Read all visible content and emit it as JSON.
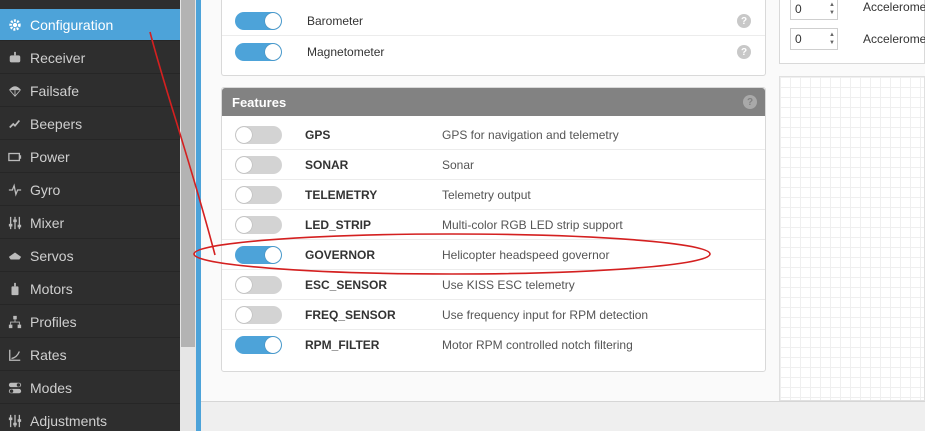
{
  "sidebar": {
    "items": [
      {
        "label": "Configuration",
        "icon": "gear-icon",
        "active": true
      },
      {
        "label": "Receiver",
        "icon": "receiver-icon"
      },
      {
        "label": "Failsafe",
        "icon": "parachute-icon"
      },
      {
        "label": "Beepers",
        "icon": "beeper-icon"
      },
      {
        "label": "Power",
        "icon": "battery-icon"
      },
      {
        "label": "Gyro",
        "icon": "pulse-icon"
      },
      {
        "label": "Mixer",
        "icon": "sliders-icon"
      },
      {
        "label": "Servos",
        "icon": "servo-icon"
      },
      {
        "label": "Motors",
        "icon": "motor-icon"
      },
      {
        "label": "Profiles",
        "icon": "tree-icon"
      },
      {
        "label": "Rates",
        "icon": "rates-icon"
      },
      {
        "label": "Modes",
        "icon": "toggle-icon"
      },
      {
        "label": "Adjustments",
        "icon": "adjust-icon"
      }
    ]
  },
  "sensors": {
    "rows": [
      {
        "label": "Barometer",
        "enabled": true
      },
      {
        "label": "Magnetometer",
        "enabled": true
      }
    ],
    "help": "?"
  },
  "features": {
    "title": "Features",
    "help": "?",
    "rows": [
      {
        "name": "GPS",
        "description": "GPS for navigation and telemetry",
        "enabled": false
      },
      {
        "name": "SONAR",
        "description": "Sonar",
        "enabled": false
      },
      {
        "name": "TELEMETRY",
        "description": "Telemetry output",
        "enabled": false
      },
      {
        "name": "LED_STRIP",
        "description": "Multi-color RGB LED strip support",
        "enabled": false
      },
      {
        "name": "GOVERNOR",
        "description": "Helicopter headspeed governor",
        "enabled": true
      },
      {
        "name": "ESC_SENSOR",
        "description": "Use KISS ESC telemetry",
        "enabled": false
      },
      {
        "name": "FREQ_SENSOR",
        "description": "Use frequency input for RPM detection",
        "enabled": false
      },
      {
        "name": "RPM_FILTER",
        "description": "Motor RPM controlled notch filtering",
        "enabled": true
      }
    ]
  },
  "accelerometer": {
    "rows": [
      {
        "value": "0",
        "label": "Acceleromet"
      },
      {
        "value": "0",
        "label": "Acceleromet"
      }
    ]
  },
  "colors": {
    "accent": "#4da3d9",
    "sidebar_bg": "#2e2e2e",
    "panel_header": "#828282",
    "annotation": "#d42020"
  }
}
